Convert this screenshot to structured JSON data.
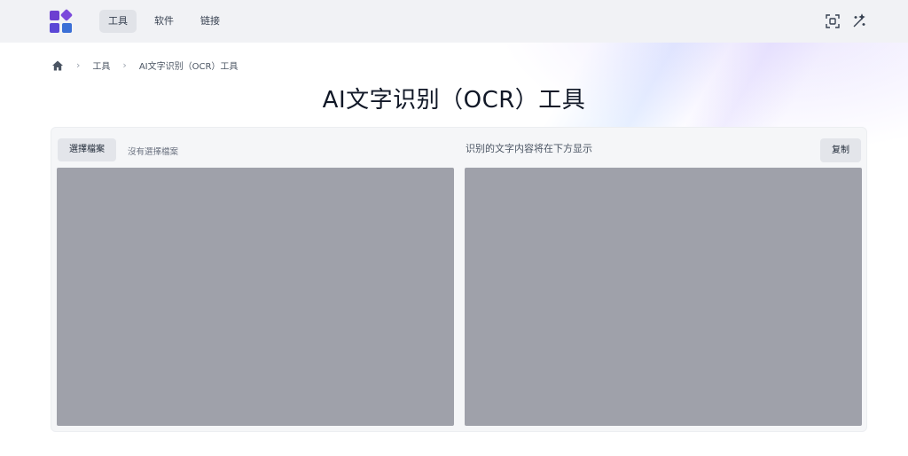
{
  "nav": {
    "items": [
      {
        "label": "工具",
        "active": true
      },
      {
        "label": "软件",
        "active": false
      },
      {
        "label": "链接",
        "active": false
      }
    ]
  },
  "top_icons": [
    "scan-icon",
    "magic-wand-icon"
  ],
  "breadcrumb": {
    "home_icon": "home-icon",
    "items": [
      "工具",
      "AI文字识别（OCR）工具"
    ]
  },
  "page": {
    "title": "AI文字识别（OCR）工具"
  },
  "tool": {
    "choose_file_label": "選擇檔案",
    "no_file_label": "沒有選擇檔案",
    "result_hint": "识别的文字内容将在下方显示",
    "copy_label": "复制"
  },
  "colors": {
    "brand_purple": "#6d3fd1",
    "brand_blue": "#3b6fd6",
    "panel_bg": "#f5f6f8",
    "box_bg": "#9fa1aa"
  }
}
